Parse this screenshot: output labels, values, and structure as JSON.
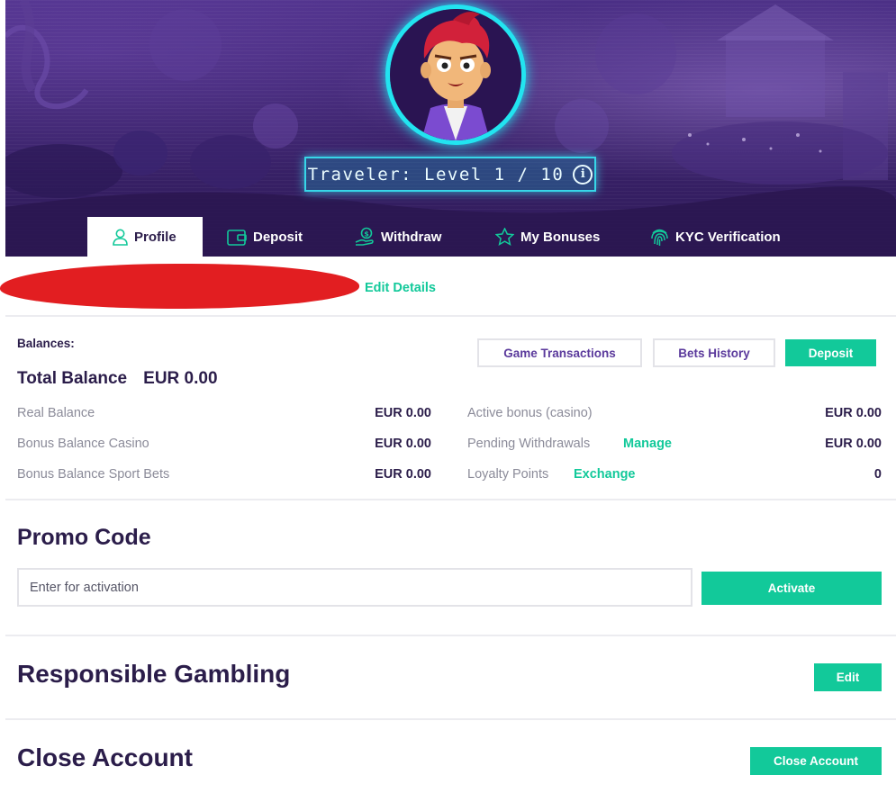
{
  "hero": {
    "level_text": "Traveler: Level 1 / 10",
    "info_glyph": "i",
    "accent_color": "#22e4f0"
  },
  "tabs": [
    {
      "label": "Profile",
      "icon": "user-icon",
      "active": true
    },
    {
      "label": "Deposit",
      "icon": "wallet-icon",
      "active": false
    },
    {
      "label": "Withdraw",
      "icon": "money-hand-icon",
      "active": false
    },
    {
      "label": "My Bonuses",
      "icon": "star-icon",
      "active": false
    },
    {
      "label": "KYC  Verification",
      "icon": "fingerprint-icon",
      "active": false
    }
  ],
  "profile": {
    "edit_details_label": "Edit Details"
  },
  "balances": {
    "heading": "Balances:",
    "buttons": {
      "game_transactions": "Game Transactions",
      "bets_history": "Bets History",
      "deposit": "Deposit"
    },
    "total_label": "Total Balance",
    "total_value": "EUR 0.00",
    "left_rows": [
      {
        "label": "Real Balance",
        "value": "EUR 0.00"
      },
      {
        "label": "Bonus Balance Casino",
        "value": "EUR 0.00"
      },
      {
        "label": "Bonus Balance Sport Bets",
        "value": "EUR 0.00"
      }
    ],
    "right_rows": [
      {
        "label": "Active bonus (casino)",
        "link": "",
        "value": "EUR 0.00"
      },
      {
        "label": "Pending Withdrawals",
        "link": "Manage",
        "value": "EUR 0.00"
      },
      {
        "label": "Loyalty Points",
        "link": "Exchange",
        "value": "0"
      }
    ]
  },
  "promo": {
    "title": "Promo Code",
    "placeholder": "Enter for activation",
    "value": "",
    "activate_label": "Activate"
  },
  "responsible": {
    "title": "Responsible Gambling",
    "edit_label": "Edit"
  },
  "close_account": {
    "title": "Close Account",
    "button_label": "Close Account"
  },
  "colors": {
    "brand_green": "#12c99a",
    "heading_purple": "#2b1d4a",
    "hero_purple": "#3c246e",
    "redaction_red": "#e21e21"
  }
}
